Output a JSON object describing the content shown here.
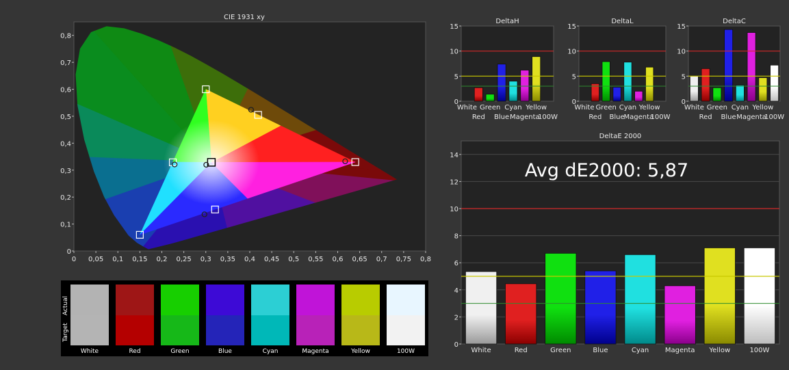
{
  "colors": {
    "background": "#353535",
    "plot_background": "#232323",
    "red_threshold": "#d42a2a",
    "yellow_threshold": "#c8c800",
    "green_threshold": "#2e8b2e"
  },
  "swatches": {
    "actual_label": "Actual",
    "target_label": "Target",
    "items": [
      {
        "name": "White",
        "actual": "#b3b3b3",
        "target": "#b4b4b4"
      },
      {
        "name": "Red",
        "actual": "#9e1616",
        "target": "#b40000"
      },
      {
        "name": "Green",
        "actual": "#17cf00",
        "target": "#16b818"
      },
      {
        "name": "Blue",
        "actual": "#3d0ad6",
        "target": "#2424b8"
      },
      {
        "name": "Cyan",
        "actual": "#2ccfd4",
        "target": "#00b8b8"
      },
      {
        "name": "Magenta",
        "actual": "#c014d8",
        "target": "#b822b8"
      },
      {
        "name": "Yellow",
        "actual": "#b8cc00",
        "target": "#b8b818"
      },
      {
        "name": "100W",
        "actual": "#e8f6ff",
        "target": "#f2f2f2"
      }
    ]
  },
  "chart_data": [
    {
      "type": "scatter",
      "title": "CIE 1931 xy",
      "xlim": [
        0,
        0.8
      ],
      "ylim": [
        0,
        0.85
      ],
      "xticks": [
        "0",
        "0,05",
        "0,1",
        "0,15",
        "0,2",
        "0,25",
        "0,3",
        "0,35",
        "0,4",
        "0,45",
        "0,5",
        "0,55",
        "0,6",
        "0,65",
        "0,7",
        "0,75",
        "0,8"
      ],
      "yticks": [
        "0",
        "0,1",
        "0,2",
        "0,3",
        "0,4",
        "0,5",
        "0,6",
        "0,7",
        "0,8"
      ],
      "target_gamut": [
        [
          0.64,
          0.33
        ],
        [
          0.3,
          0.6
        ],
        [
          0.15,
          0.06
        ]
      ],
      "series": [
        {
          "name": "Target",
          "marker": "square",
          "points": [
            [
              0.64,
              0.33
            ],
            [
              0.3,
              0.6
            ],
            [
              0.15,
              0.06
            ],
            [
              0.225,
              0.329
            ],
            [
              0.321,
              0.154
            ],
            [
              0.419,
              0.505
            ],
            [
              0.3127,
              0.329
            ]
          ]
        },
        {
          "name": "Actual",
          "marker": "circle",
          "points": [
            [
              0.617,
              0.333
            ],
            [
              0.403,
              0.524
            ],
            [
              0.229,
              0.321
            ],
            [
              0.297,
              0.136
            ],
            [
              0.301,
              0.32
            ]
          ]
        }
      ]
    },
    {
      "type": "bar",
      "title": "DeltaH",
      "categories": [
        "White",
        "Red",
        "Green",
        "Blue",
        "Cyan",
        "Magenta",
        "Yellow",
        "100W"
      ],
      "values": [
        0,
        2.7,
        1.4,
        7.4,
        4.0,
        6.2,
        8.9,
        0
      ],
      "ylim": [
        0,
        15
      ],
      "yticks": [
        0,
        5,
        10,
        15
      ],
      "thresholds": [
        10,
        5,
        3
      ]
    },
    {
      "type": "bar",
      "title": "DeltaL",
      "categories": [
        "White",
        "Red",
        "Green",
        "Blue",
        "Cyan",
        "Magenta",
        "Yellow",
        "100W"
      ],
      "values": [
        0,
        3.5,
        7.9,
        2.8,
        7.8,
        2.0,
        6.8,
        0
      ],
      "ylim": [
        0,
        15
      ],
      "yticks": [
        0,
        5,
        10,
        15
      ],
      "thresholds": [
        10,
        5,
        3
      ]
    },
    {
      "type": "bar",
      "title": "DeltaC",
      "categories": [
        "White",
        "Red",
        "Green",
        "Blue",
        "Cyan",
        "Magenta",
        "Yellow",
        "100W"
      ],
      "values": [
        5.0,
        6.5,
        2.7,
        14.3,
        3.2,
        13.7,
        4.7,
        7.2
      ],
      "ylim": [
        0,
        15
      ],
      "yticks": [
        0,
        5,
        10,
        15
      ],
      "thresholds": [
        10,
        5,
        3
      ]
    },
    {
      "type": "bar",
      "title": "DeltaE 2000",
      "annotation": "Avg dE2000: 5,87",
      "categories": [
        "White",
        "Red",
        "Green",
        "Blue",
        "Cyan",
        "Magenta",
        "Yellow",
        "100W"
      ],
      "values": [
        5.35,
        4.45,
        6.7,
        5.4,
        6.6,
        4.3,
        7.1,
        7.1
      ],
      "ylim": [
        0,
        15
      ],
      "yticks": [
        0,
        2,
        4,
        6,
        8,
        10,
        12,
        14
      ],
      "thresholds": [
        10,
        5,
        3
      ]
    }
  ]
}
